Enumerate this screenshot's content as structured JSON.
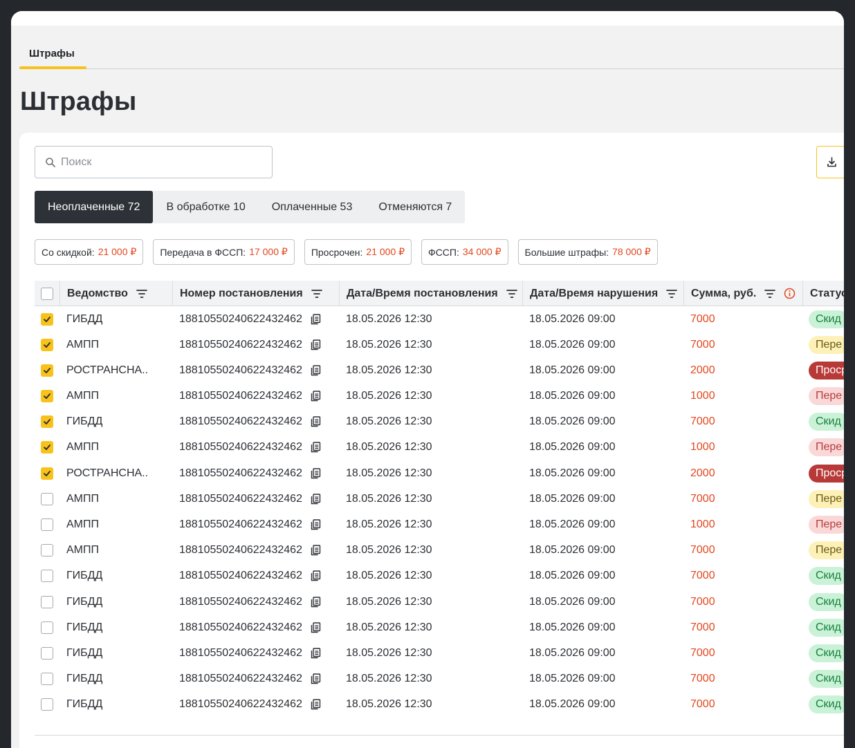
{
  "tabs": [
    {
      "label": "Штрафы"
    }
  ],
  "page_title": "Штрафы",
  "search": {
    "placeholder": "Поиск"
  },
  "segments": [
    {
      "label": "Неоплаченные 72",
      "active": true
    },
    {
      "label": "В обработке 10",
      "active": false
    },
    {
      "label": "Оплаченные 53",
      "active": false
    },
    {
      "label": "Отменяются 7",
      "active": false
    }
  ],
  "chips": [
    {
      "label": "Со скидкой:",
      "amount": "21 000 ₽"
    },
    {
      "label": "Передача в ФССП:",
      "amount": "17 000 ₽"
    },
    {
      "label": "Просрочен:",
      "amount": "21 000 ₽"
    },
    {
      "label": "ФССП:",
      "amount": "34 000 ₽"
    },
    {
      "label": "Большие штрафы:",
      "amount": "78 000 ₽"
    }
  ],
  "columns": {
    "agency": "Ведомство",
    "number": "Номер постановления",
    "decree_dt": "Дата/Время постановления",
    "violation_dt": "Дата/Время нарушения",
    "sum": "Сумма, руб.",
    "status": "Статус"
  },
  "colors": {
    "accent": "#f8c21b",
    "dark": "#2d3238",
    "amount": "#e2461d",
    "status_green": "#c9f2d6",
    "status_yellow": "#fdf1b8",
    "status_pink": "#fbd8d8",
    "status_red": "#b83a38"
  },
  "rows": [
    {
      "checked": true,
      "agency": "ГИБДД",
      "number": "18810550240622432462",
      "decree_dt": "18.05.2026 12:30",
      "violation_dt": "18.05.2026 09:00",
      "sum": "7000",
      "status": "Скид",
      "status_color": "green"
    },
    {
      "checked": true,
      "agency": "АМПП",
      "number": "18810550240622432462",
      "decree_dt": "18.05.2026 12:30",
      "violation_dt": "18.05.2026 09:00",
      "sum": "7000",
      "status": "Пере",
      "status_color": "yellow"
    },
    {
      "checked": true,
      "agency": "РОСТРАНСНА..",
      "number": "18810550240622432462",
      "decree_dt": "18.05.2026 12:30",
      "violation_dt": "18.05.2026 09:00",
      "sum": "2000",
      "status": "Проср",
      "status_color": "red"
    },
    {
      "checked": true,
      "agency": "АМПП",
      "number": "18810550240622432462",
      "decree_dt": "18.05.2026 12:30",
      "violation_dt": "18.05.2026 09:00",
      "sum": "1000",
      "status": "Пере",
      "status_color": "pink"
    },
    {
      "checked": true,
      "agency": "ГИБДД",
      "number": "18810550240622432462",
      "decree_dt": "18.05.2026 12:30",
      "violation_dt": "18.05.2026 09:00",
      "sum": "7000",
      "status": "Скид",
      "status_color": "green"
    },
    {
      "checked": true,
      "agency": "АМПП",
      "number": "18810550240622432462",
      "decree_dt": "18.05.2026 12:30",
      "violation_dt": "18.05.2026 09:00",
      "sum": "1000",
      "status": "Пере",
      "status_color": "pink"
    },
    {
      "checked": true,
      "agency": "РОСТРАНСНА..",
      "number": "18810550240622432462",
      "decree_dt": "18.05.2026 12:30",
      "violation_dt": "18.05.2026 09:00",
      "sum": "2000",
      "status": "Проср",
      "status_color": "red"
    },
    {
      "checked": false,
      "agency": "АМПП",
      "number": "18810550240622432462",
      "decree_dt": "18.05.2026 12:30",
      "violation_dt": "18.05.2026 09:00",
      "sum": "7000",
      "status": "Пере",
      "status_color": "yellow"
    },
    {
      "checked": false,
      "agency": "АМПП",
      "number": "18810550240622432462",
      "decree_dt": "18.05.2026 12:30",
      "violation_dt": "18.05.2026 09:00",
      "sum": "1000",
      "status": "Пере",
      "status_color": "pink"
    },
    {
      "checked": false,
      "agency": "АМПП",
      "number": "18810550240622432462",
      "decree_dt": "18.05.2026 12:30",
      "violation_dt": "18.05.2026 09:00",
      "sum": "7000",
      "status": "Пере",
      "status_color": "yellow"
    },
    {
      "checked": false,
      "agency": "ГИБДД",
      "number": "18810550240622432462",
      "decree_dt": "18.05.2026 12:30",
      "violation_dt": "18.05.2026 09:00",
      "sum": "7000",
      "status": "Скид",
      "status_color": "green"
    },
    {
      "checked": false,
      "agency": "ГИБДД",
      "number": "18810550240622432462",
      "decree_dt": "18.05.2026 12:30",
      "violation_dt": "18.05.2026 09:00",
      "sum": "7000",
      "status": "Скид",
      "status_color": "green"
    },
    {
      "checked": false,
      "agency": "ГИБДД",
      "number": "18810550240622432462",
      "decree_dt": "18.05.2026 12:30",
      "violation_dt": "18.05.2026 09:00",
      "sum": "7000",
      "status": "Скид",
      "status_color": "green"
    },
    {
      "checked": false,
      "agency": "ГИБДД",
      "number": "18810550240622432462",
      "decree_dt": "18.05.2026 12:30",
      "violation_dt": "18.05.2026 09:00",
      "sum": "7000",
      "status": "Скид",
      "status_color": "green"
    },
    {
      "checked": false,
      "agency": "ГИБДД",
      "number": "18810550240622432462",
      "decree_dt": "18.05.2026 12:30",
      "violation_dt": "18.05.2026 09:00",
      "sum": "7000",
      "status": "Скид",
      "status_color": "green"
    },
    {
      "checked": false,
      "agency": "ГИБДД",
      "number": "18810550240622432462",
      "decree_dt": "18.05.2026 12:30",
      "violation_dt": "18.05.2026 09:00",
      "sum": "7000",
      "status": "Скид",
      "status_color": "green"
    }
  ]
}
